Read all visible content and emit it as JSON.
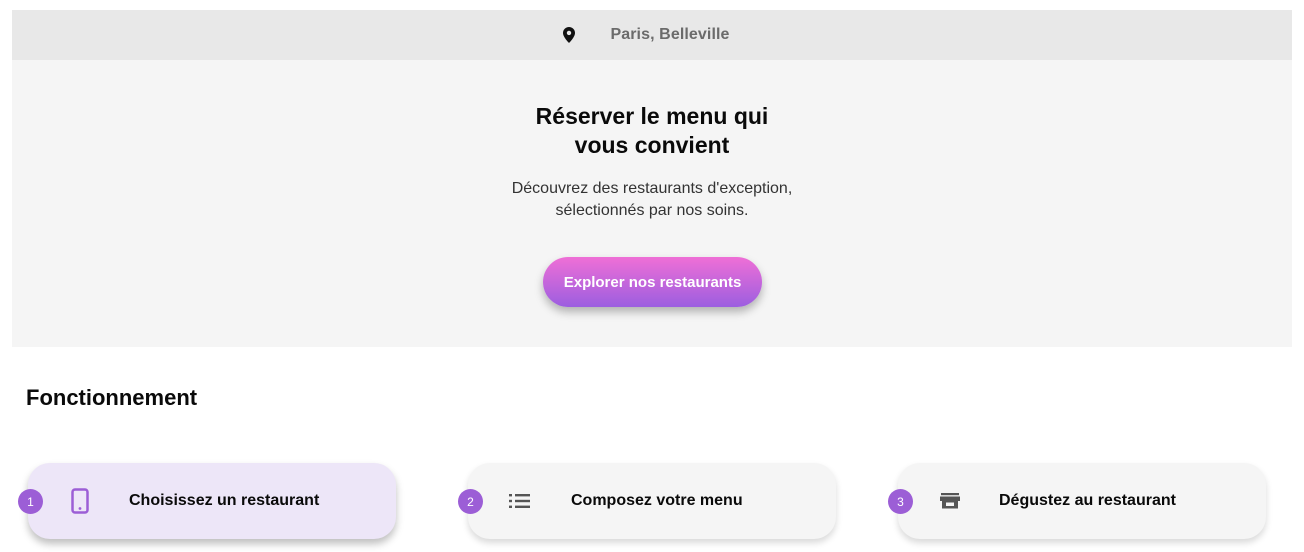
{
  "header": {
    "location_icon": "map-pin-icon",
    "location": "Paris, Belleville"
  },
  "hero": {
    "title_line1": "Réserver le menu qui",
    "title_line2": "vous convient",
    "subtitle_line1": "Découvrez des restaurants d'exception,",
    "subtitle_line2": "sélectionnés par nos soins.",
    "cta_label": "Explorer nos restaurants"
  },
  "how_it_works": {
    "title": "Fonctionnement",
    "steps": [
      {
        "number": "1",
        "icon": "smartphone-icon",
        "label": "Choisissez un restaurant",
        "active": true
      },
      {
        "number": "2",
        "icon": "list-icon",
        "label": "Composez votre menu",
        "active": false
      },
      {
        "number": "3",
        "icon": "store-icon",
        "label": "Dégustez au restaurant",
        "active": false
      }
    ]
  },
  "colors": {
    "accent": "#9c5ed6",
    "cta_gradient_start": "#ef6fd6",
    "cta_gradient_end": "#9c5ee0",
    "active_step_bg": "#ede6f8"
  }
}
